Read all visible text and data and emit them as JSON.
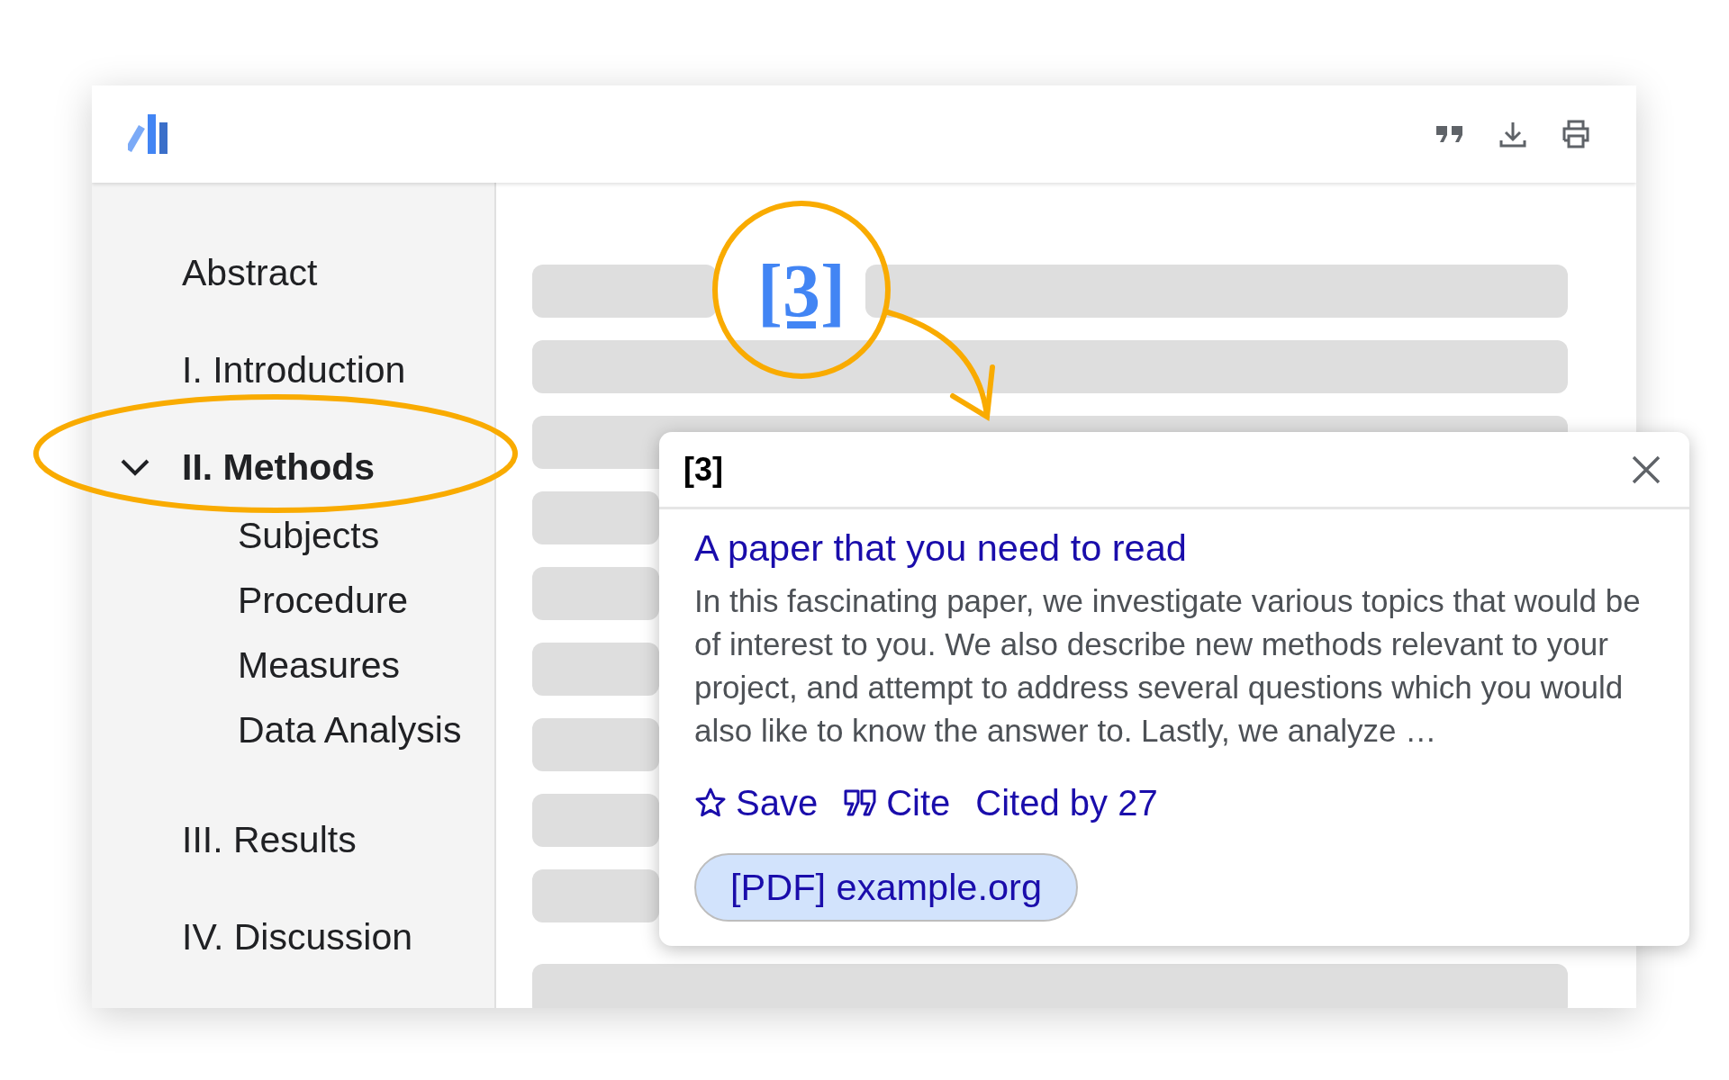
{
  "sidebar": {
    "items": [
      {
        "label": "Abstract",
        "selected": false
      },
      {
        "label": "I. Introduction",
        "selected": false
      },
      {
        "label": "II. Methods",
        "selected": true,
        "expanded": true,
        "children": [
          {
            "label": "Subjects"
          },
          {
            "label": "Procedure"
          },
          {
            "label": "Measures"
          },
          {
            "label": "Data Analysis"
          }
        ]
      },
      {
        "label": "III. Results",
        "selected": false
      },
      {
        "label": "IV. Discussion",
        "selected": false
      }
    ]
  },
  "content": {
    "citation_marker": "[3]"
  },
  "popup": {
    "marker": "[3]",
    "title": "A paper that you need to read",
    "snippet": "In this fascinating paper, we investigate various topics that would be of interest to you. We also describe new methods relevant to your project, and attempt to address several questions which you would also like to know the answer to. Lastly, we analyze …",
    "actions": [
      {
        "kind": "save",
        "label": "Save"
      },
      {
        "kind": "cite",
        "label": "Cite"
      },
      {
        "kind": "cited_by",
        "label": "Cited by 27"
      }
    ],
    "pdf_link": "[PDF] example.org"
  }
}
